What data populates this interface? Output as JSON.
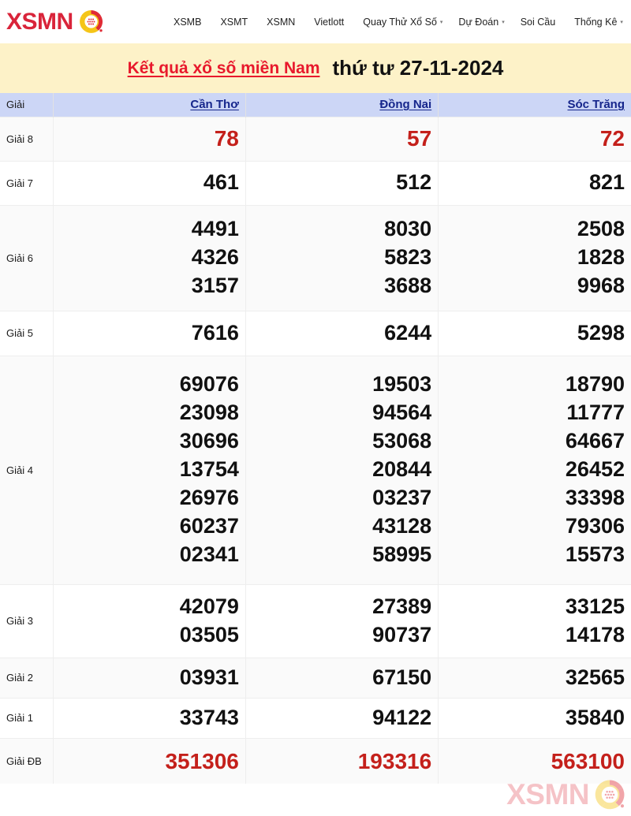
{
  "header": {
    "logo_text": "XSMN",
    "logo_icon": "lottery-ball-icon",
    "nav": [
      {
        "label": "XSMB",
        "caret": ""
      },
      {
        "label": "XSMT",
        "caret": ""
      },
      {
        "label": "XSMN",
        "caret": ""
      },
      {
        "label": "Vietlott",
        "caret": ""
      },
      {
        "label": "Quay Thử Xổ Số",
        "caret": "▾"
      },
      {
        "label": "Dự Đoán",
        "caret": "▾"
      },
      {
        "label": "Soi Cầu",
        "caret": ""
      },
      {
        "label": "Thống Kê",
        "caret": "▾"
      }
    ]
  },
  "title": {
    "main": "Kết quả xổ số miền Nam",
    "date": "thứ tư 27-11-2024"
  },
  "table": {
    "prize_header": "Giải",
    "provinces": [
      "Cần Thơ",
      "Đồng Nai",
      "Sóc Trăng"
    ],
    "rows": [
      {
        "prize": "Giải 8",
        "highlight": true,
        "values": [
          [
            "78"
          ],
          [
            "57"
          ],
          [
            "72"
          ]
        ]
      },
      {
        "prize": "Giải 7",
        "highlight": false,
        "values": [
          [
            "461"
          ],
          [
            "512"
          ],
          [
            "821"
          ]
        ]
      },
      {
        "prize": "Giải 6",
        "highlight": false,
        "values": [
          [
            "4491",
            "4326",
            "3157"
          ],
          [
            "8030",
            "5823",
            "3688"
          ],
          [
            "2508",
            "1828",
            "9968"
          ]
        ]
      },
      {
        "prize": "Giải 5",
        "highlight": false,
        "values": [
          [
            "7616"
          ],
          [
            "6244"
          ],
          [
            "5298"
          ]
        ]
      },
      {
        "prize": "Giải 4",
        "highlight": false,
        "values": [
          [
            "69076",
            "23098",
            "30696",
            "13754",
            "26976",
            "60237",
            "02341"
          ],
          [
            "19503",
            "94564",
            "53068",
            "20844",
            "03237",
            "43128",
            "58995"
          ],
          [
            "18790",
            "11777",
            "64667",
            "26452",
            "33398",
            "79306",
            "15573"
          ]
        ]
      },
      {
        "prize": "Giải 3",
        "highlight": false,
        "values": [
          [
            "42079",
            "03505"
          ],
          [
            "27389",
            "90737"
          ],
          [
            "33125",
            "14178"
          ]
        ]
      },
      {
        "prize": "Giải 2",
        "highlight": false,
        "values": [
          [
            "03931"
          ],
          [
            "67150"
          ],
          [
            "32565"
          ]
        ]
      },
      {
        "prize": "Giải 1",
        "highlight": false,
        "values": [
          [
            "33743"
          ],
          [
            "94122"
          ],
          [
            "35840"
          ]
        ]
      },
      {
        "prize": "Giải ĐB",
        "highlight": true,
        "values": [
          [
            "351306"
          ],
          [
            "193316"
          ],
          [
            "563100"
          ]
        ]
      }
    ]
  },
  "watermark": {
    "text": "XSMN",
    "icon": "lottery-ball-icon"
  },
  "colors": {
    "brand_red": "#d9243a",
    "title_red": "#e8192c",
    "highlight_red": "#c4201b",
    "header_blue": "#ccd6f6",
    "province_link": "#16268c",
    "title_band": "#fdf2c8"
  }
}
